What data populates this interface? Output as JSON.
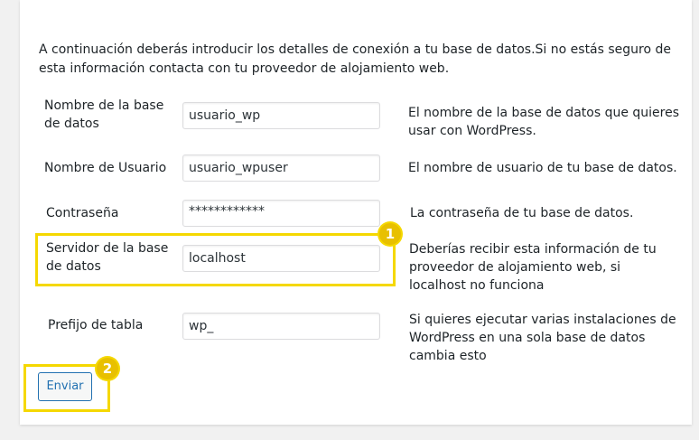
{
  "intro_text": "A continuación deberás introducir los detalles de conexión a tu base de datos.Si no estás seguro de esta información contacta con tu proveedor de alojamiento web.",
  "fields": [
    {
      "label_line1": "Nombre de la base",
      "label_line2": "de datos",
      "value": "usuario_wp",
      "help_line1": "El nombre de la base de datos que quieres",
      "help_line2": "usar con WordPress."
    },
    {
      "label": "Nombre de Usuario",
      "value": "usuario_wpuser",
      "help": "El nombre de usuario de tu base de datos."
    },
    {
      "label": "Contraseña",
      "value": "************",
      "help": "La contraseña de tu base de datos."
    },
    {
      "label_line1": "Servidor de la base",
      "label_line2": "de datos",
      "value": "localhost",
      "help_line1": "Deberías recibir esta información de tu",
      "help_line2": "proveedor de alojamiento web, si",
      "help_line3": "localhost  no funciona"
    },
    {
      "label": "Prefijo de tabla",
      "value": "wp_",
      "help_line1": "Si quieres ejecutar varias instalaciones de",
      "help_line2": "WordPress en una sola base de datos",
      "help_line3": "cambia esto"
    }
  ],
  "submit_label": "Enviar",
  "badges": [
    "1",
    "2"
  ],
  "colors": {
    "highlight": "#f5d800",
    "badge": "#e8c000",
    "button_border": "#2271b1"
  }
}
